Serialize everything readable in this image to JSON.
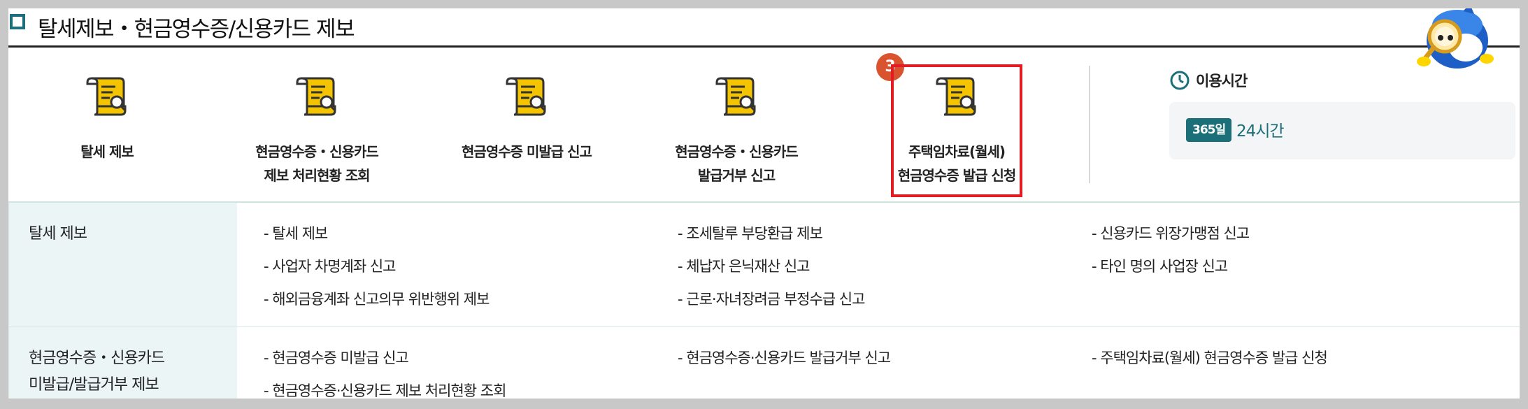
{
  "header": {
    "title": "탈세제보・현금영수증/신용카드 제보"
  },
  "menu": {
    "items": [
      {
        "label": "탈세 제보"
      },
      {
        "label": "현금영수증・신용카드\n제보 처리현황 조회"
      },
      {
        "label": "현금영수증 미발급 신고"
      },
      {
        "label": "현금영수증・신용카드\n발급거부 신고"
      },
      {
        "label": "주택임차료(월세)\n현금영수증 발급 신청"
      }
    ],
    "step_badge": "3",
    "highlight_color": "#e31b23"
  },
  "service_time": {
    "label": "이용시간",
    "days": "365일",
    "hours": "24시간"
  },
  "table": {
    "rows": [
      {
        "header": "탈세 제보",
        "links": [
          "- 탈세 제보",
          "- 조세탈루 부당환급 제보",
          "- 신용카드 위장가맹점 신고",
          "- 사업자 차명계좌 신고",
          "- 체납자 은닉재산 신고",
          "- 타인 명의 사업장 신고",
          "- 해외금융계좌 신고의무 위반행위 제보",
          "- 근로·자녀장려금 부정수급 신고"
        ]
      },
      {
        "header": "현금영수증・신용카드\n미발급/발급거부 제보",
        "links": [
          "- 현금영수증 미발급 신고",
          "- 현금영수증·신용카드 발급거부 신고",
          "- 주택임차료(월세) 현금영수증 발급 신청",
          "- 현금영수증·신용카드 제보 처리현황 조회"
        ]
      }
    ]
  },
  "colors": {
    "brand_teal": "#1b6f78",
    "table_header_bg": "#ebf5f5",
    "icon_yellow": "#f5c400"
  }
}
